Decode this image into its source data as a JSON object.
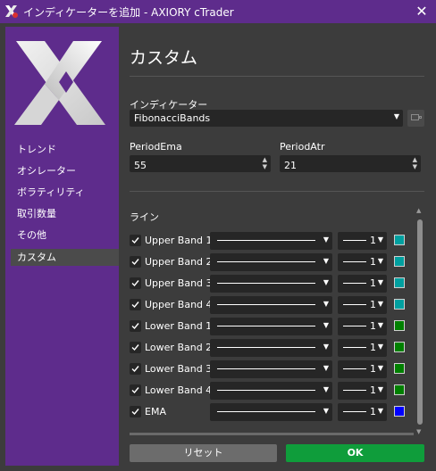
{
  "window": {
    "title": "インディケーターを追加 - AXIORY cTrader",
    "close_symbol": "✕"
  },
  "sidebar": {
    "items": [
      {
        "label": "トレンド"
      },
      {
        "label": "オシレーター"
      },
      {
        "label": "ボラティリティ"
      },
      {
        "label": "取引数量"
      },
      {
        "label": "その他"
      },
      {
        "label": "カスタム"
      }
    ],
    "active": "カスタム"
  },
  "main": {
    "heading": "カスタム",
    "indicator_label": "インディケーター",
    "indicator_value": "FibonacciBands",
    "params": [
      {
        "label": "PeriodEma",
        "value": "55"
      },
      {
        "label": "PeriodAtr",
        "value": "21"
      }
    ],
    "lines_label": "ライン",
    "lines": [
      {
        "label": "Upper Band 1",
        "checked": true,
        "width": "1",
        "color": "#00a0a0"
      },
      {
        "label": "Upper Band 2",
        "checked": true,
        "width": "1",
        "color": "#00a0a0"
      },
      {
        "label": "Upper Band 3",
        "checked": true,
        "width": "1",
        "color": "#00a0a0"
      },
      {
        "label": "Upper Band 4",
        "checked": true,
        "width": "1",
        "color": "#00a0a0"
      },
      {
        "label": "Lower Band 1",
        "checked": true,
        "width": "1",
        "color": "#008000"
      },
      {
        "label": "Lower Band 2",
        "checked": true,
        "width": "1",
        "color": "#008000"
      },
      {
        "label": "Lower Band 3",
        "checked": true,
        "width": "1",
        "color": "#008000"
      },
      {
        "label": "Lower Band 4",
        "checked": true,
        "width": "1",
        "color": "#008000"
      },
      {
        "label": "EMA",
        "checked": true,
        "width": "1",
        "color": "#0000ff"
      }
    ]
  },
  "buttons": {
    "reset": "リセット",
    "ok": "OK"
  },
  "colors": {
    "brand": "#5e2c8c",
    "ok": "#0f9d3b",
    "reset": "#6c6c6c",
    "background": "#3c3c3c"
  },
  "icons": {
    "app": "axiory-ctrader-icon",
    "logo": "axiory-x-logo",
    "close": "close-icon"
  }
}
